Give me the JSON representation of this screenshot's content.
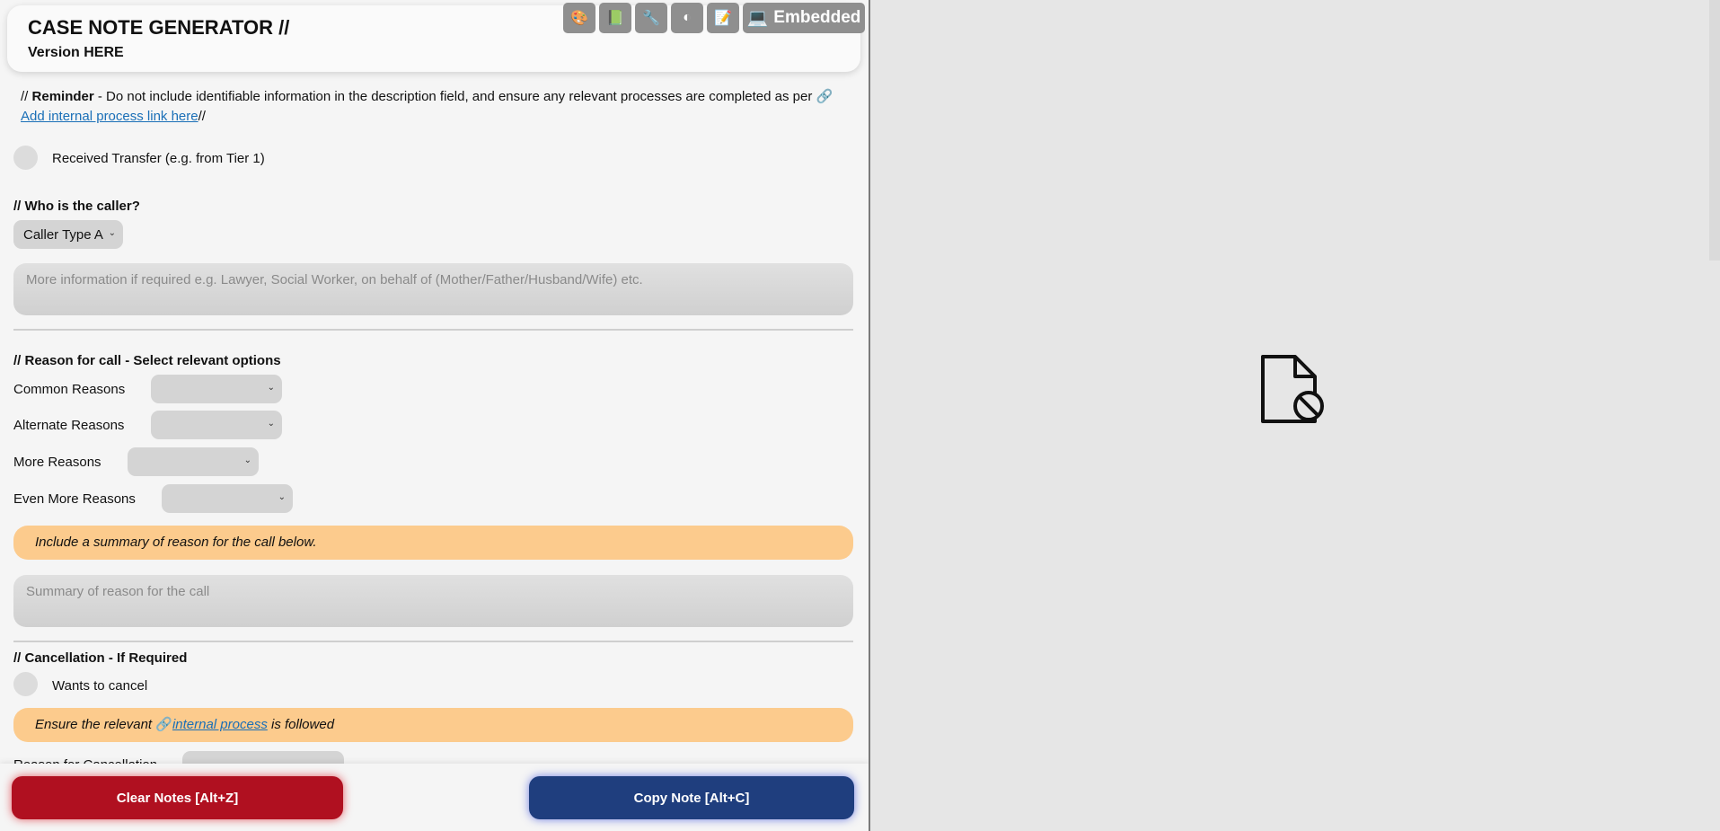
{
  "header": {
    "title": "CASE NOTE GENERATOR //",
    "version": "Version HERE",
    "toolbar": {
      "icons": [
        "palette-icon",
        "book-icon",
        "wrench-icon",
        "contrast-icon",
        "notepad-icon",
        "laptop-icon"
      ],
      "embedded_label": "Embedded"
    }
  },
  "reminder": {
    "prefix": "// ",
    "bold": "Reminder",
    "text": " - Do not include identifiable information in the description field, and ensure any relevant processes are completed as per ",
    "link": "Add internal process link here",
    "suffix": "//"
  },
  "transfer": {
    "label": "Received Transfer (e.g. from Tier 1)"
  },
  "caller": {
    "heading": "// Who is the caller?",
    "select_value": "Caller Type A",
    "more_info_placeholder": "More information if required e.g. Lawyer, Social Worker, on behalf of (Mother/Father/Husband/Wife) etc."
  },
  "reason": {
    "heading": "// Reason for call - Select relevant options",
    "rows": [
      {
        "label": "Common Reasons",
        "value": ""
      },
      {
        "label": "Alternate Reasons",
        "value": ""
      },
      {
        "label": "More Reasons",
        "value": ""
      },
      {
        "label": "Even More Reasons",
        "value": ""
      }
    ],
    "banner": "Include a summary of reason for the call below.",
    "summary_placeholder": "Summary of reason for the call"
  },
  "cancellation": {
    "heading": "// Cancellation - If Required",
    "wants_cancel_label": "Wants to cancel",
    "banner_pre": "Ensure the relevant ",
    "banner_link": "internal process",
    "banner_post": " is followed",
    "reason_label": "Reason for Cancellation"
  },
  "footer": {
    "clear_label": "Clear Notes [Alt+Z]",
    "copy_label": "Copy Note [Alt+C]"
  }
}
